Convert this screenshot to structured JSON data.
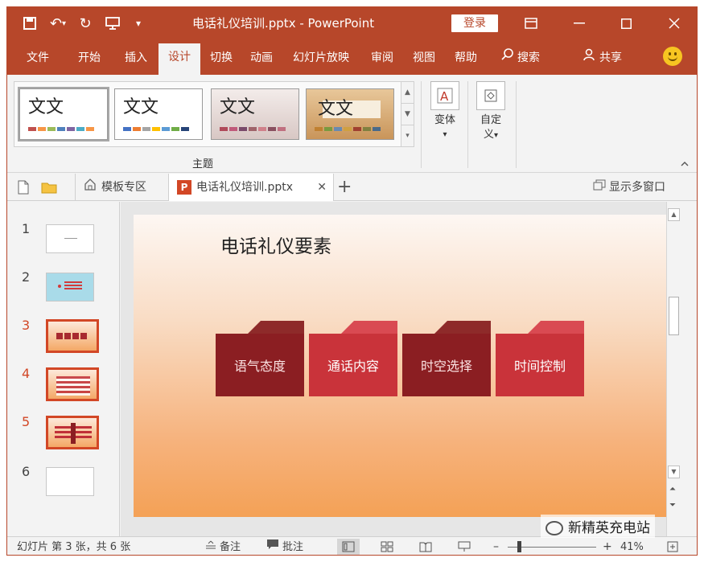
{
  "titlebar": {
    "title": "电话礼仪培训.pptx  -  PowerPoint",
    "login": "登录",
    "undo_glyph": "↶",
    "redo_glyph": "↻",
    "more_glyph": "▾"
  },
  "ribbon_tabs": [
    "文件",
    "开始",
    "插入",
    "设计",
    "切换",
    "动画",
    "幻灯片放映",
    "审阅",
    "视图",
    "帮助",
    "搜索",
    "共享"
  ],
  "design_group": {
    "themes_label": "主题",
    "theme_text": "文文",
    "variant_label": "变体",
    "customize_label1": "自定",
    "customize_label2": "义",
    "dropdown_glyph": "▾"
  },
  "theme_swatches": [
    [
      "#c0504d",
      "#f79646",
      "#9bbb59",
      "#4f81bd",
      "#8064a2",
      "#4bacc6",
      "#f79646"
    ],
    [
      "#4472c4",
      "#ed7d31",
      "#a5a5a5",
      "#ffc000",
      "#5b9bd5",
      "#70ad47",
      "#264478"
    ],
    [
      "#b04a5a",
      "#c05a7a",
      "#7a4a6a",
      "#a0646a",
      "#d0808a",
      "#8a5060",
      "#c07080"
    ],
    [
      "#c08030",
      "#7a9a40",
      "#6a8ab0",
      "#d0a040",
      "#a04030",
      "#808040",
      "#4a6a8a"
    ]
  ],
  "doc_tabs": {
    "templates": "模板专区",
    "file": "电话礼仪培训.pptx",
    "ppt_badge": "P",
    "close": "✕",
    "add": "+",
    "multi_window": "显示多窗口"
  },
  "thumbnails": [
    {
      "num": "1",
      "selected": false
    },
    {
      "num": "2",
      "selected": false
    },
    {
      "num": "3",
      "selected": true
    },
    {
      "num": "4",
      "selected": true
    },
    {
      "num": "5",
      "selected": true
    },
    {
      "num": "6",
      "selected": false
    }
  ],
  "slide": {
    "title": "电话礼仪要素",
    "folders": [
      "语气态度",
      "通话内容",
      "时空选择",
      "时间控制"
    ]
  },
  "status": {
    "slide_info": "幻灯片 第 3 张，共 6 张",
    "notes": "备注",
    "comments": "批注",
    "zoom_minus": "–",
    "zoom_plus": "+",
    "zoom": "41%"
  },
  "watermark": "新精英充电站",
  "colors": {
    "accent": "#b7472a",
    "selected_thumb": "#d24726",
    "folder_dark": "#8b1e22",
    "folder_light": "#c9333a"
  }
}
